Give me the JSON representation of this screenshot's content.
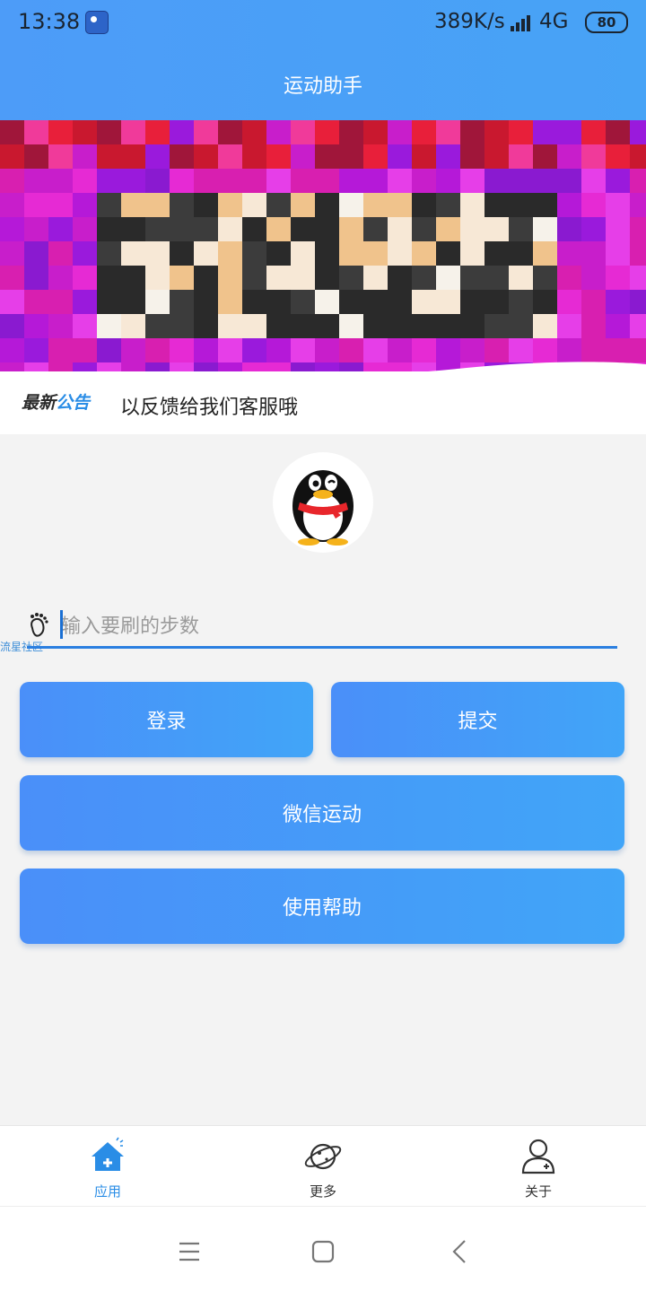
{
  "status_bar": {
    "time": "13:38",
    "network_speed": "389K/s",
    "network_type": "4G",
    "battery": "80"
  },
  "app": {
    "title": "运动助手"
  },
  "notice": {
    "logo_part1": "最新",
    "logo_part2": "公告",
    "text": "以反馈给我们客服哦"
  },
  "steps": {
    "placeholder": "输入要刷的步数",
    "value": "",
    "watermark": "流星社区"
  },
  "buttons": {
    "login": "登录",
    "submit": "提交",
    "wechat": "微信运动",
    "help": "使用帮助"
  },
  "tabs": [
    {
      "label": "应用",
      "icon": "home-plus-icon",
      "active": true
    },
    {
      "label": "更多",
      "icon": "planet-icon",
      "active": false
    },
    {
      "label": "关于",
      "icon": "user-icon",
      "active": false
    }
  ],
  "colors": {
    "header_blue": "#4d9cf8",
    "accent_blue": "#2a8de6",
    "button_gradient_start": "#4a8ff9",
    "button_gradient_end": "#41a5f8"
  }
}
